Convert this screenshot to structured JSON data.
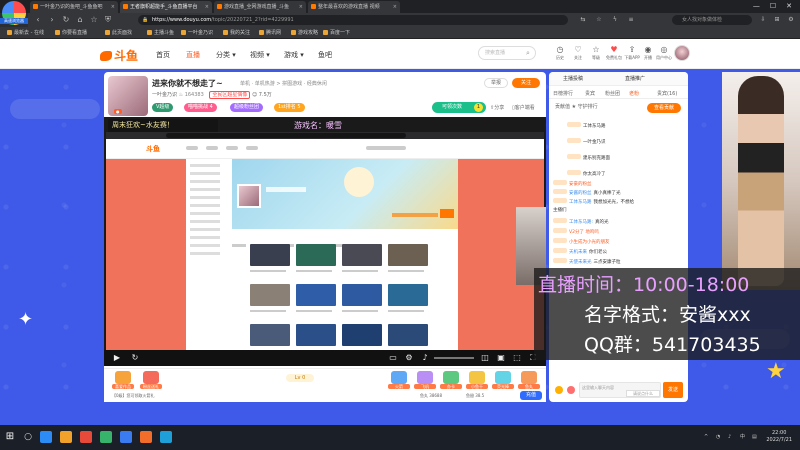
{
  "browser": {
    "logo_label": "高速浏览器",
    "tabs": [
      {
        "label": "一叶金乃识的鱼吧_斗鱼鱼吧",
        "active": false
      },
      {
        "label": "王者旗帜超能手_斗鱼直播平台",
        "active": true
      },
      {
        "label": "游戏直播_全网游戏直播_斗鱼",
        "active": false
      },
      {
        "label": "整年最喜欢的游戏直播 视频",
        "active": false
      }
    ],
    "url_host": "https://www.douyu.com",
    "url_path": "/topic/20220721_2?rid=4229991",
    "search_placeholder": "女人找对象做体检",
    "bookmarks": [
      "最新去 - 在线",
      "你要看直播",
      "此页面找",
      "主播斗鱼",
      "一叶金乃识",
      "我的关注",
      "腾讯网",
      "游戏攻略",
      "百度一下"
    ]
  },
  "site": {
    "logo": "斗鱼",
    "nav": [
      {
        "label": "首页",
        "active": false
      },
      {
        "label": "直播",
        "active": true
      },
      {
        "label": "分类 ▾",
        "active": false
      },
      {
        "label": "视频 ▾",
        "active": false
      },
      {
        "label": "游戏 ▾",
        "active": false
      },
      {
        "label": "鱼吧",
        "active": false
      }
    ],
    "search_placeholder": "搜索直播",
    "header_icons": [
      {
        "icon": "history-icon",
        "glyph": "◷",
        "label": "历史"
      },
      {
        "icon": "follow-icon",
        "glyph": "♡",
        "label": "关注"
      },
      {
        "icon": "level-icon",
        "glyph": "☆",
        "label": "等级"
      },
      {
        "icon": "gift-icon",
        "glyph": "♥",
        "label": "免费礼包"
      },
      {
        "icon": "upload-icon",
        "glyph": "⇪",
        "label": "下载APP"
      },
      {
        "icon": "live-icon",
        "glyph": "◉",
        "label": "开播"
      },
      {
        "icon": "center-icon",
        "glyph": "◎",
        "label": "用户中心"
      }
    ]
  },
  "room": {
    "title": "进来你就不想走了~",
    "category": "单机 · 单机热游 > 拼图游戏 · 经典休闲",
    "streamer": "一叶金乃识",
    "hot": "164383",
    "badge": "全民区超星偶像",
    "followers": "7.5万",
    "tags": [
      {
        "label": "V超级",
        "color": "#2f9a6f"
      },
      {
        "label": "喵喵挑战 4",
        "color": "#ff5d8e"
      },
      {
        "label": "超级粉丝团",
        "color": "#a36cff"
      },
      {
        "label": "1st排名 5",
        "color": "#ffa520"
      }
    ],
    "report": "举报",
    "follow": "关注",
    "opportunity": "可领次数",
    "opportunity_count": "1",
    "share": "分享",
    "client": "客户端看"
  },
  "video": {
    "banner": "周末狂欢~水友赛！",
    "game_name": "游戏名：暖雪",
    "inner_logo": "斗鱼"
  },
  "gifts": {
    "items": [
      {
        "label": "喜爱作品",
        "color": "#f7a33b"
      },
      {
        "label": "粉丝送礼",
        "color": "#f56b5b"
      },
      {
        "label": "火箭",
        "color": "#5fa8f6"
      },
      {
        "label": "飞机",
        "color": "#b98ef5"
      },
      {
        "label": "办卡",
        "color": "#5cc880"
      },
      {
        "label": "小鱼干",
        "color": "#f4c542"
      },
      {
        "label": "荧光棒",
        "color": "#63d3e6"
      },
      {
        "label": "鱼丸",
        "color": "#f59a5a"
      }
    ],
    "level": "Lv 0",
    "footer_text": "【0级】您可领取火箭礼",
    "balance_yuwan": "鱼丸 38688",
    "balance_yuchi": "鱼翅 38.5",
    "recharge": "充值"
  },
  "chat": {
    "top_tabs": [
      "主播投稿",
      "直播推广"
    ],
    "tabs": [
      {
        "label": "日榜排行",
        "active": false
      },
      {
        "label": "贵宾",
        "active": false
      },
      {
        "label": "粉丝团",
        "active": false
      },
      {
        "label": "老粉",
        "active": true
      },
      {
        "label": "贵宾(16)",
        "active": false
      }
    ],
    "sub_label": "贡献值 ★ 守护排行",
    "rank_button": "查看贡献",
    "messages": [
      {
        "name": "",
        "text": "工体东马路"
      },
      {
        "name": "",
        "text": "一叶金乃识"
      },
      {
        "name": "",
        "text": "建乐别克路面"
      },
      {
        "name": "",
        "text": "你太高冷了"
      },
      {
        "name": "",
        "text": "安豪的粉丝"
      },
      {
        "name": "安酱的粉丝",
        "text": "真小真棒了光"
      },
      {
        "name": "工体东马路",
        "text": "我想加光光，不想给"
      },
      {
        "name": "",
        "text": "主播们"
      },
      {
        "name": "工体东马路:",
        "text": "真的光"
      },
      {
        "name": "",
        "text": "V2分了 地鸣鸣"
      },
      {
        "name": "",
        "text": "小生成为小光的朋友"
      },
      {
        "name": "天机未来",
        "text": "你们老公"
      },
      {
        "name": "天使未来光",
        "text": "三点安康子粒"
      }
    ],
    "input_placeholder": "这里输入聊天内容",
    "input_hint": "请说点什么",
    "send": "发送"
  },
  "overlay": {
    "time_line": "直播时间：10:00-18:00",
    "name_line": "名字格式：安酱xxx",
    "qq_line": "QQ群：541703435",
    "colors": {
      "time": "#e8a0ff",
      "name": "#ffffff",
      "qq": "#ffffff"
    }
  },
  "taskbar": {
    "time": "22:00",
    "date": "2022/7/21",
    "icon_colors": [
      "#2c8bf4",
      "#f0a22a",
      "#e84a3a",
      "#37b36b",
      "#3b7bf2",
      "#f26d2a",
      "#1f9fd8"
    ]
  }
}
